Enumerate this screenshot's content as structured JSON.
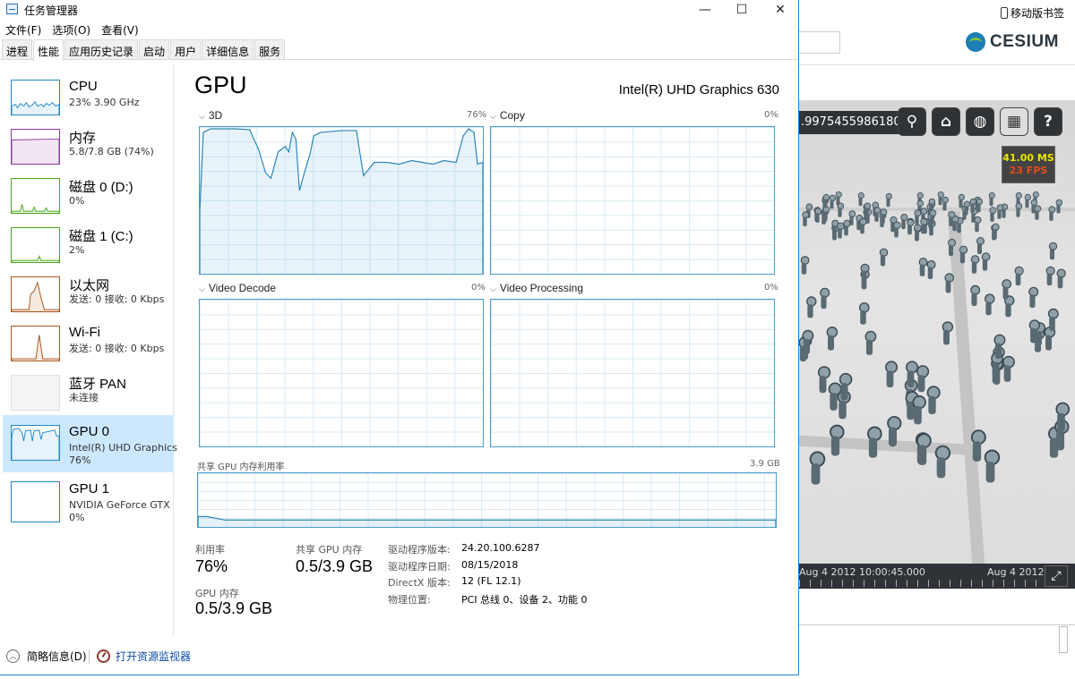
{
  "window": {
    "title": "任务管理器",
    "minimize": "—",
    "maximize": "☐",
    "close": "✕"
  },
  "menu": [
    "文件(F)",
    "选项(O)",
    "查看(V)"
  ],
  "tabs": [
    "进程",
    "性能",
    "应用历史记录",
    "启动",
    "用户",
    "详细信息",
    "服务"
  ],
  "active_tab": "性能",
  "sidebar": [
    {
      "name": "CPU",
      "sub": "23% 3.90 GHz",
      "color": "#1e88c7"
    },
    {
      "name": "内存",
      "sub": "5.8/7.8 GB (74%)",
      "color": "#8b3a9e"
    },
    {
      "name": "磁盘 0 (D:)",
      "sub": "0%",
      "color": "#4da81f"
    },
    {
      "name": "磁盘 1 (C:)",
      "sub": "2%",
      "color": "#4da81f"
    },
    {
      "name": "以太网",
      "sub": "发送: 0 接收: 0 Kbps",
      "color": "#a7561c"
    },
    {
      "name": "Wi-Fi",
      "sub": "发送: 0 接收: 0 Kbps",
      "color": "#a7561c"
    },
    {
      "name": "蓝牙 PAN",
      "sub": "未连接",
      "color": "#d0d0d0"
    },
    {
      "name": "GPU 0",
      "sub": "Intel(R) UHD Graphics",
      "sub2": "76%",
      "color": "#1e88c7",
      "active": true
    },
    {
      "name": "GPU 1",
      "sub": "NVIDIA GeForce GTX",
      "sub2": "0%",
      "color": "#1e88c7"
    }
  ],
  "gpu": {
    "title": "GPU",
    "device": "Intel(R) UHD Graphics 630",
    "engines": [
      {
        "name": "3D",
        "pct": "76%"
      },
      {
        "name": "Copy",
        "pct": "0%"
      },
      {
        "name": "Video Decode",
        "pct": "0%"
      },
      {
        "name": "Video Processing",
        "pct": "0%"
      }
    ],
    "shared_mem": {
      "label": "共享 GPU 内存利用率",
      "max": "3.9 GB"
    },
    "stats": {
      "util_label": "利用率",
      "util_value": "76%",
      "shared_label": "共享 GPU 内存",
      "shared_value": "0.5/3.9 GB",
      "gpumem_label": "GPU 内存",
      "gpumem_value": "0.5/3.9 GB"
    },
    "details": [
      {
        "key": "驱动程序版本:",
        "value": "24.20.100.6287"
      },
      {
        "key": "驱动程序日期:",
        "value": "08/15/2018"
      },
      {
        "key": "DirectX 版本:",
        "value": "12 (FL 12.1)"
      },
      {
        "key": "物理位置:",
        "value": "PCI 总线 0、设备 2、功能 0"
      }
    ]
  },
  "footer": {
    "fewer_details": "简略信息(D)",
    "open_monitor": "打开资源监视器"
  },
  "browser": {
    "bookmark": "移动版书签",
    "logo": "CESIUM",
    "coords": ".99754559861802",
    "perf_ms": "41.00 MS",
    "perf_fps": "23 FPS",
    "time_left": "Aug 4 2012 10:00:45.000",
    "time_right": "Aug 4 2012",
    "buttons": [
      "search-icon",
      "home-icon",
      "globe-icon",
      "map-layers-icon",
      "help-icon"
    ]
  }
}
